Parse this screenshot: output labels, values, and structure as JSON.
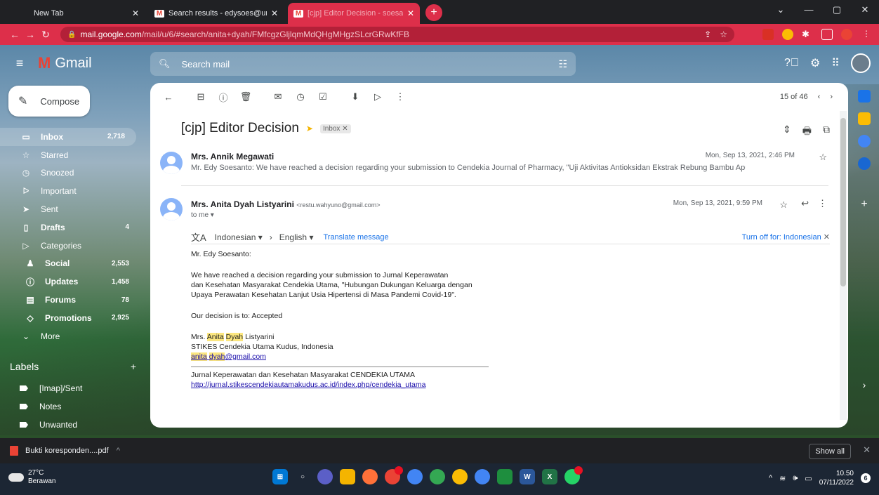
{
  "browser": {
    "tabs": [
      {
        "title": "New Tab",
        "active": false
      },
      {
        "title": "Search results - edysoes@unimus",
        "active": false
      },
      {
        "title": "[cjp] Editor Decision - soesanto",
        "active": true
      }
    ],
    "url_host": "mail.google.com",
    "url_path": "/mail/u/6/#search/anita+dyah/FMfcgzGljlqmMdQHgMHgzSLcrGRwKfFB"
  },
  "gmail": {
    "app_name": "Gmail",
    "search_placeholder": "Search mail",
    "compose_label": "Compose",
    "sidebar": [
      {
        "label": "Inbox",
        "count": "2,718",
        "icon": "inbox-icon",
        "bold": true,
        "active": true
      },
      {
        "label": "Starred",
        "count": "",
        "icon": "star-icon"
      },
      {
        "label": "Snoozed",
        "count": "",
        "icon": "clock-icon"
      },
      {
        "label": "Important",
        "count": "",
        "icon": "important-icon"
      },
      {
        "label": "Sent",
        "count": "",
        "icon": "send-icon"
      },
      {
        "label": "Drafts",
        "count": "4",
        "icon": "draft-icon",
        "bold": true
      },
      {
        "label": "Categories",
        "count": "",
        "icon": "label-icon"
      },
      {
        "label": "Social",
        "count": "2,553",
        "icon": "people-icon",
        "bold": true,
        "sub": true
      },
      {
        "label": "Updates",
        "count": "1,458",
        "icon": "info-icon",
        "bold": true,
        "sub": true
      },
      {
        "label": "Forums",
        "count": "78",
        "icon": "forum-icon",
        "bold": true,
        "sub": true
      },
      {
        "label": "Promotions",
        "count": "2,925",
        "icon": "tag-icon",
        "bold": true,
        "sub": true
      },
      {
        "label": "More",
        "count": "",
        "icon": "chevron-down-icon"
      }
    ],
    "labels_title": "Labels",
    "labels": [
      "[Imap]/Sent",
      "Notes",
      "Unwanted"
    ],
    "pager": "15 of 46"
  },
  "thread": {
    "subject": "[cjp] Editor Decision",
    "inbox_chip": "Inbox",
    "msg1": {
      "sender": "Mrs. Annik Megawati",
      "snippet": "Mr. Edy Soesanto: We have reached a decision regarding your submission to Cendekia Journal of Pharmacy, \"Uji Aktivitas Antioksidan Ekstrak Rebung Bambu Apus (Gi",
      "date": "Mon, Sep 13, 2021, 2:46 PM"
    },
    "msg2": {
      "sender": "Mrs. Anita Dyah Listyarini",
      "email": "<restu.wahyuno@gmail.com>",
      "to": "to me",
      "date": "Mon, Sep 13, 2021, 9:59 PM",
      "translate_from": "Indonesian",
      "translate_to": "English",
      "translate_link": "Translate message",
      "turn_off": "Turn off for: Indonesian",
      "greeting": "Mr. Edy Soesanto:",
      "line1": "We have reached a decision regarding your submission to Jurnal Keperawatan",
      "line2": "dan Kesehatan Masyarakat Cendekia Utama, \"Hubungan Dukungan Keluarga dengan",
      "line3": "Upaya Perawatan Kesehatan Lanjut Usia Hipertensi di Masa Pandemi Covid-19\".",
      "decision": "Our decision is to: Accepted",
      "sig_mrs": "Mrs.",
      "sig_anita": "Anita",
      "sig_dyah": "Dyah",
      "sig_last": "Listyarini",
      "sig_org": "STIKES Cendekia Utama Kudus, Indonesia",
      "sig_email_a": "anita",
      "sig_email_b": "dyah",
      "sig_email_c": "@gmail.com",
      "journal": "Jurnal Keperawatan dan Kesehatan Masyarakat CENDEKIA UTAMA",
      "journal_url": "http://jurnal.stikescendekiautamakudus.ac.id/index.php/cendekia_utama"
    }
  },
  "download": {
    "file": "Bukti koresponden....pdf",
    "show_all": "Show all"
  },
  "taskbar": {
    "temp": "27°C",
    "weather": "Berawan",
    "time": "10.50",
    "date": "07/11/2022",
    "notif_count": "6"
  }
}
